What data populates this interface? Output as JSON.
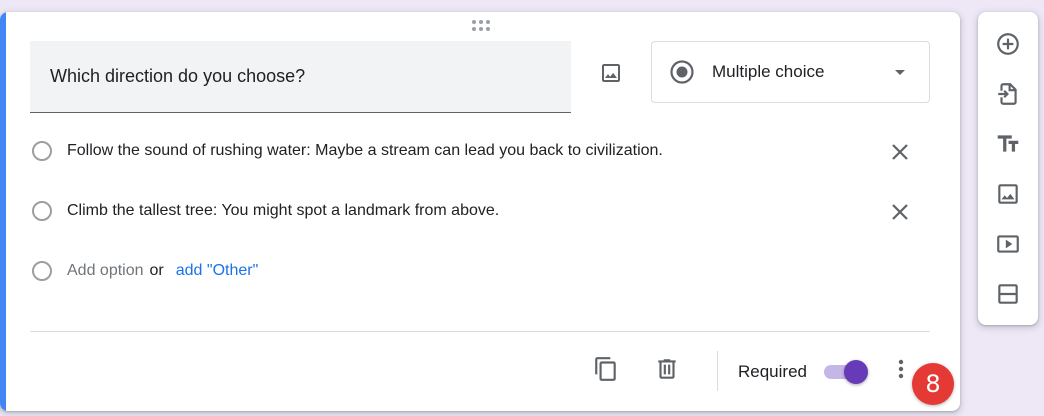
{
  "question": {
    "title": "Which direction do you choose?",
    "type_label": "Multiple choice"
  },
  "options": [
    {
      "label": "Follow the sound of rushing water: Maybe a stream can lead you back to civilization."
    },
    {
      "label": "Climb the tallest tree: You might spot a landmark from above."
    }
  ],
  "add_option": {
    "label": "Add option",
    "or": "or",
    "other_link": "add \"Other\""
  },
  "footer": {
    "required_label": "Required",
    "required_on": true,
    "badge": "8"
  },
  "icons": {
    "image": "image-icon",
    "radio": "radio-checked-icon",
    "caret": "caret-down-icon",
    "close": "close-icon",
    "copy": "copy-icon",
    "delete": "trash-icon",
    "more": "more-vert-icon",
    "add_question": "add-circle-icon",
    "import": "import-icon",
    "title": "title-icon",
    "add_image": "image-icon",
    "video": "video-icon",
    "section": "section-icon"
  },
  "colors": {
    "accent": "#4285f4",
    "brand": "#673ab7",
    "badge": "#e53935",
    "link": "#1a73e8"
  }
}
